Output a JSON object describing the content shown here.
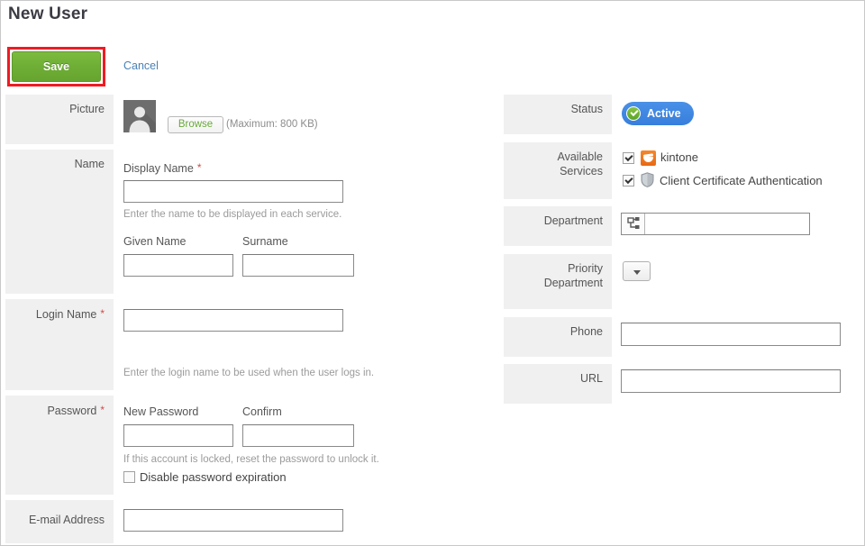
{
  "page": {
    "title": "New User"
  },
  "toolbar": {
    "save_label": "Save",
    "cancel_label": "Cancel"
  },
  "left_column": {
    "picture": {
      "label": "Picture",
      "avatar_icon": "user-avatar-icon",
      "browse_label": "Browse",
      "max_note": "(Maximum: 800 KB)"
    },
    "name": {
      "label": "Name",
      "display_name_label": "Display Name",
      "display_name_required": "*",
      "display_name_value": "",
      "display_name_hint": "Enter the name to be displayed in each service.",
      "given_name_label": "Given Name",
      "given_name_value": "",
      "surname_label": "Surname",
      "surname_value": ""
    },
    "login_name": {
      "label": "Login Name",
      "required": "*",
      "value": "",
      "hint": "Enter the login name to be used when the user logs in."
    },
    "password": {
      "label": "Password",
      "required": "*",
      "new_password_label": "New Password",
      "new_password_value": "",
      "confirm_label": "Confirm",
      "confirm_value": "",
      "hint": "If this account is locked, reset the password to unlock it.",
      "disable_expiration_label": "Disable password expiration",
      "disable_expiration_checked": false
    },
    "email": {
      "label": "E-mail Address",
      "value": ""
    }
  },
  "right_column": {
    "status": {
      "label": "Status",
      "badge_label": "Active",
      "badge_icon": "check-circle-icon"
    },
    "available_services": {
      "label": "Available Services",
      "label_line1": "Available",
      "label_line2": "Services",
      "items": [
        {
          "name": "kintone",
          "icon": "kintone-icon",
          "checked": true
        },
        {
          "name": "Client Certificate Authentication",
          "icon": "shield-icon",
          "checked": true
        }
      ]
    },
    "department": {
      "label": "Department",
      "picker_icon": "org-tree-icon",
      "value": ""
    },
    "priority_department": {
      "label": "Priority Department",
      "label_line1": "Priority",
      "label_line2": "Department",
      "selected": "",
      "dropdown_icon": "chevron-down-icon"
    },
    "phone": {
      "label": "Phone",
      "value": ""
    },
    "url": {
      "label": "URL",
      "value": ""
    }
  },
  "colors": {
    "save_green": "#6fae36",
    "highlight_red": "#ee1c22",
    "link_blue": "#4a82b4",
    "status_blue": "#377fdc",
    "label_bg": "#f0f0f0",
    "required_red": "#d24a4a",
    "kintone_orange": "#e96a13"
  }
}
